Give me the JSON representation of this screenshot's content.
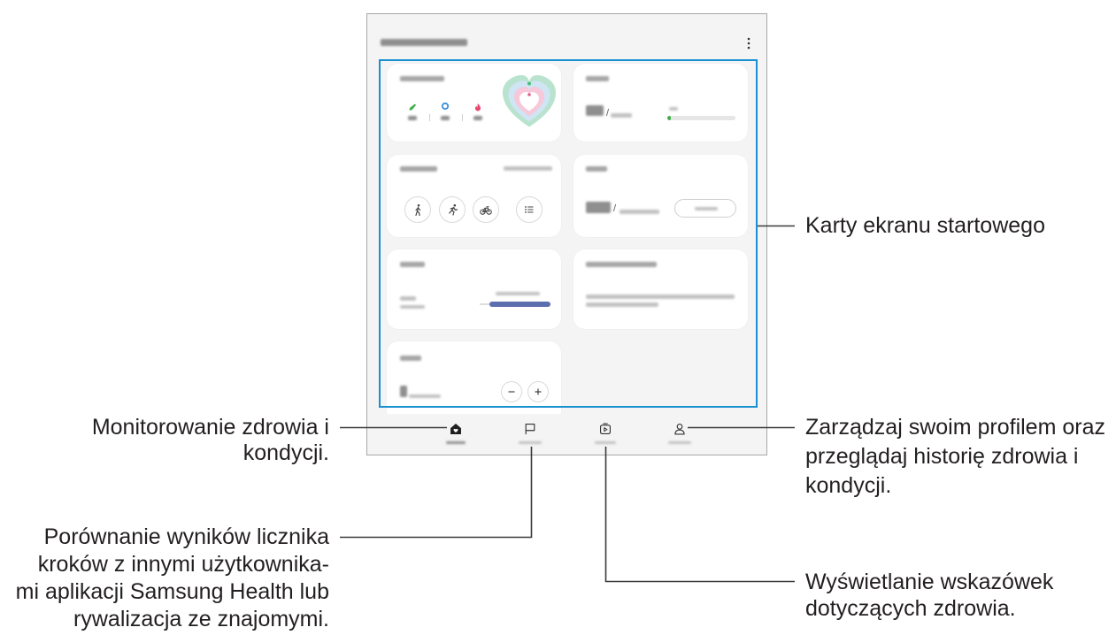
{
  "callouts": {
    "home_cards": [
      "Karty ekranu startowego"
    ],
    "profile": [
      "Zarządzaj swoim profilem oraz",
      "przeglądaj historię zdrowia i",
      "kondycji."
    ],
    "tips": [
      "Wyświetlanie wskazówek",
      "dotyczących zdrowia."
    ],
    "monitoring": [
      "Monitorowanie zdrowia i",
      "kondycji."
    ],
    "together": [
      "Porównanie wyników licznika",
      "kroków z innymi użytkownika-",
      "mi aplikacji Samsung Health lub",
      "rywalizacja ze znajomymi."
    ]
  },
  "colors": {
    "highlight_border": "#1a8fd1",
    "callout_line": "#3a3a3a",
    "steps_progress": "#3fae4a",
    "sleep_bar": "#5b6fae",
    "steps_icon": "#3fae4a",
    "active_time_icon": "#3a8fd9",
    "calories_icon": "#e5486d",
    "heart_outer": "#b9e3cf",
    "heart_middle": "#cfe5f4",
    "heart_inner": "#f6c8d9"
  },
  "header": {
    "menu_icon": "more-vertical-icon"
  },
  "cards": {
    "daily_activity": {
      "icons": [
        "steps-icon",
        "active-time-icon",
        "calories-icon"
      ],
      "chart_icon": "activity-heart-icon"
    },
    "steps": {
      "separator": "/",
      "progress": 0.05
    },
    "exercise": {
      "icons": [
        "walking-icon",
        "running-icon",
        "cycling-icon",
        "list-icon"
      ]
    },
    "food": {
      "separator": "/"
    },
    "water": {
      "icons": [
        "minus-icon",
        "plus-icon"
      ]
    }
  },
  "nav": [
    {
      "icon": "home-icon",
      "active": true
    },
    {
      "icon": "flag-icon"
    },
    {
      "icon": "play-box-icon"
    },
    {
      "icon": "person-icon"
    }
  ]
}
